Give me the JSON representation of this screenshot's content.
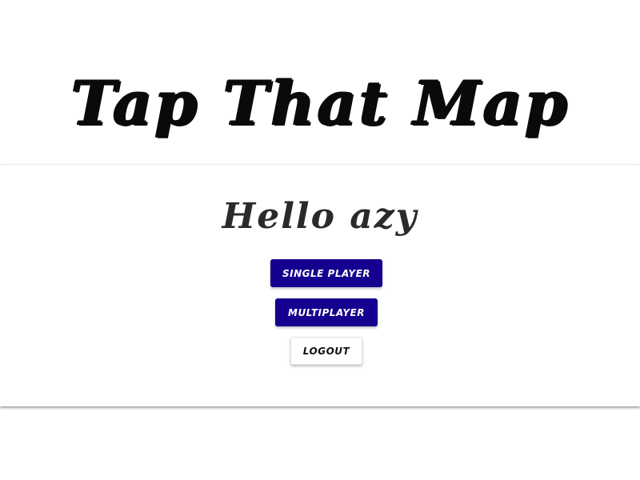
{
  "app": {
    "title": "Tap That Map"
  },
  "menu": {
    "greeting": "Hello azy",
    "single_player_label": "Single Player",
    "multiplayer_label": "Multiplayer",
    "logout_label": "Logout"
  },
  "colors": {
    "primary_button": "#16008f",
    "primary_button_text": "#ffffff",
    "secondary_button": "#ffffff",
    "title_text": "#0a0a0a"
  }
}
